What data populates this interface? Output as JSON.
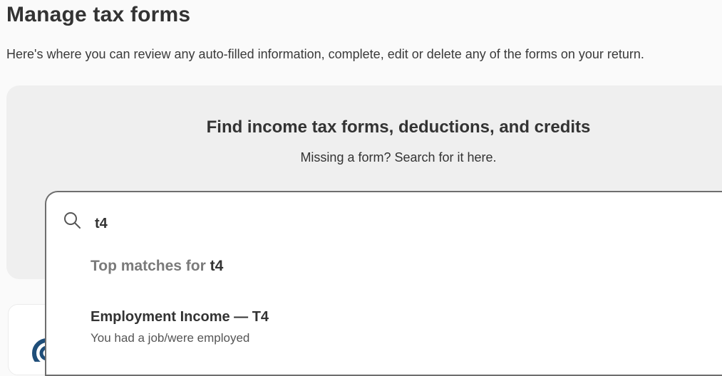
{
  "header": {
    "title": "Manage tax forms",
    "description": "Here's where you can review any auto-filled information, complete, edit or delete any of the forms on your return."
  },
  "search_panel": {
    "title": "Find income tax forms, deductions, and credits",
    "subtitle": "Missing a form? Search for it here."
  },
  "search": {
    "value": "t4",
    "icon": "search-icon"
  },
  "results": {
    "heading_prefix": "Top matches for ",
    "heading_query": "t4",
    "items": [
      {
        "title": "Employment Income — T4",
        "description": "You had a job/were employed"
      }
    ]
  },
  "colors": {
    "background": "#fafafa",
    "panel": "#efefef",
    "text": "#333333",
    "muted": "#7a7a7a",
    "logo": "#1f4e79"
  }
}
